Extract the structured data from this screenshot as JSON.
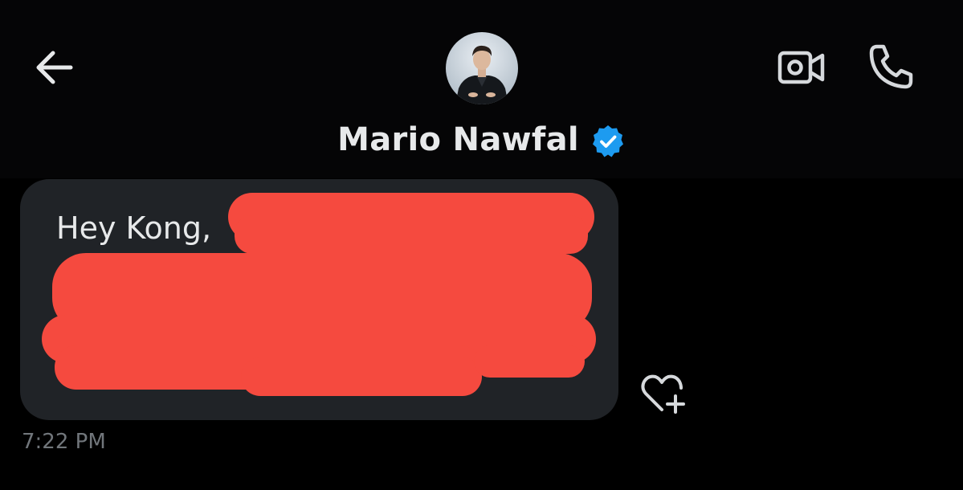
{
  "header": {
    "contact_name": "Mario Nawfal",
    "verified": true,
    "icons": {
      "back": "arrow-left-icon",
      "avatar": "profile-photo",
      "verified": "verified-badge-icon",
      "video": "video-call-icon",
      "call": "phone-icon"
    }
  },
  "message": {
    "text": "Hey Kong,",
    "redacted": true,
    "timestamp": "7:22 PM",
    "reaction_icon": "heart-plus-icon"
  },
  "colors": {
    "background": "#000000",
    "header_background": "#050506",
    "bubble": "#202327",
    "text": "#e7e9ea",
    "muted_text": "#71767b",
    "verified": "#1d9bf0",
    "redaction": "#f54a3f",
    "icon": "#d6d9dc"
  }
}
